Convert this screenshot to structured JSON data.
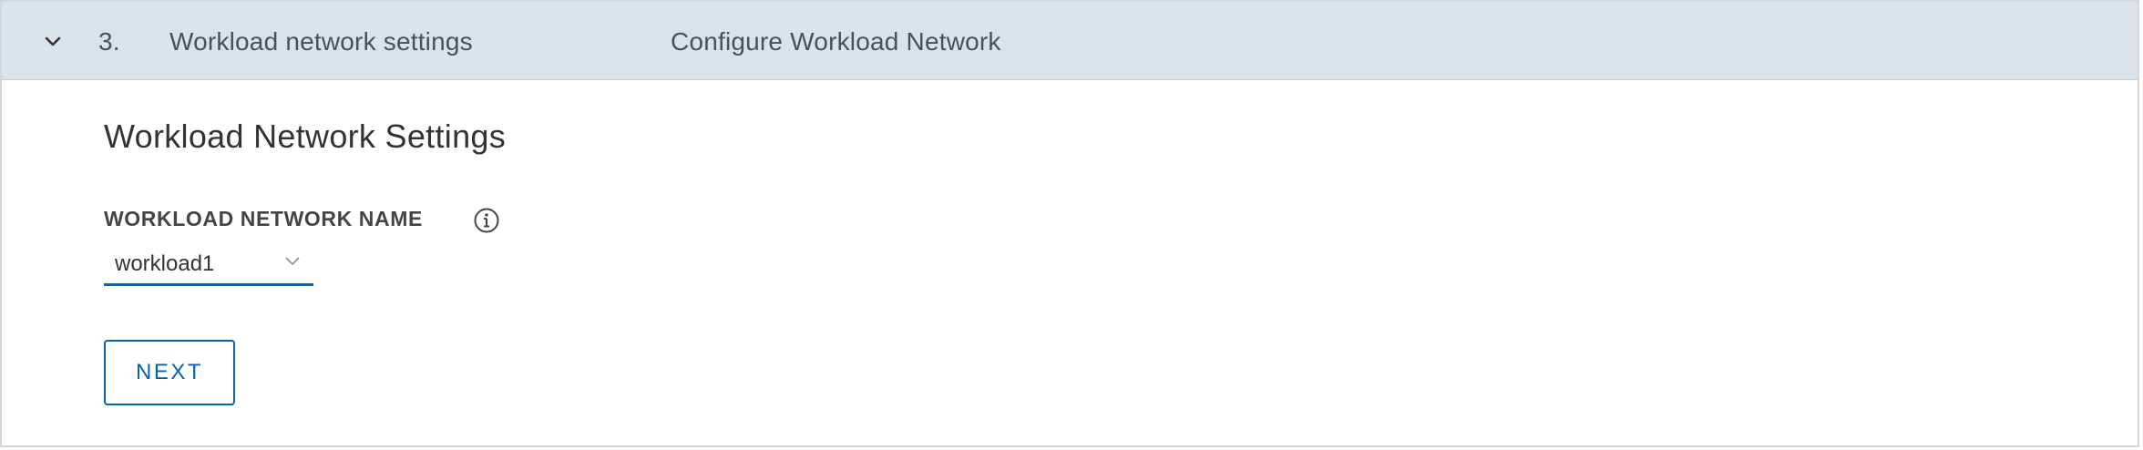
{
  "step": {
    "number": "3.",
    "title": "Workload network settings",
    "description": "Configure Workload Network",
    "expanded_icon": "chevron-down-icon"
  },
  "section": {
    "title": "Workload Network Settings"
  },
  "workload_network_name": {
    "label": "WORKLOAD NETWORK NAME",
    "info_icon": "info-circle-icon",
    "selected_value": "workload1",
    "caret_icon": "chevron-down-icon"
  },
  "actions": {
    "next_label": "NEXT"
  },
  "colors": {
    "header_background": "#dbe3e8",
    "accent": "#0b63a5",
    "text": "#333333",
    "muted_text": "#4a5157"
  }
}
